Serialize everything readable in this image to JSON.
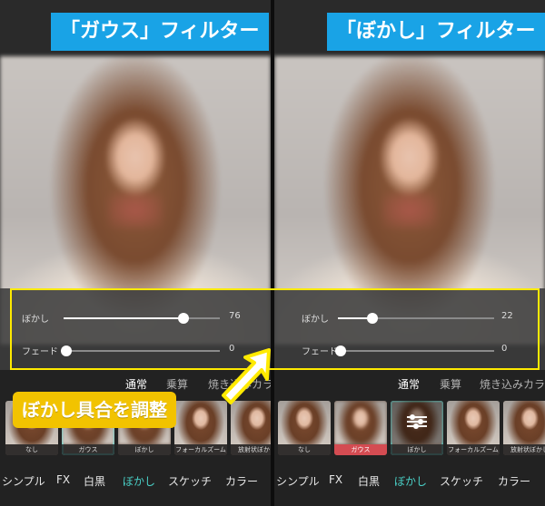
{
  "left": {
    "title": "「ガウス」フィルター",
    "sliders": [
      {
        "label": "ぼかし",
        "value": "76",
        "level": 76
      },
      {
        "label": "フェード",
        "value": "0",
        "level": 0
      }
    ],
    "modes": [
      {
        "label": "通常",
        "active": true
      },
      {
        "label": "乗算",
        "active": false
      },
      {
        "label": "焼き込みカラー",
        "active": false
      }
    ],
    "thumbs": [
      {
        "label": "なし"
      },
      {
        "label": "ガウス",
        "selected": true
      },
      {
        "label": "ぼかし"
      },
      {
        "label": "フォーカルズーム"
      },
      {
        "label": "放射状ぼかし"
      }
    ],
    "categories": [
      {
        "label": "シンプル",
        "active": false
      },
      {
        "label": "FX",
        "active": false
      },
      {
        "label": "白黒",
        "active": false
      },
      {
        "label": "ぼかし",
        "active": true
      },
      {
        "label": "スケッチ",
        "active": false
      },
      {
        "label": "カラー",
        "active": false
      }
    ]
  },
  "right": {
    "title": "「ぼかし」フィルター",
    "sliders": [
      {
        "label": "ぼかし",
        "value": "22",
        "level": 22
      },
      {
        "label": "フェード",
        "value": "0",
        "level": 0
      }
    ],
    "modes": [
      {
        "label": "通常",
        "active": true
      },
      {
        "label": "乗算",
        "active": false
      },
      {
        "label": "焼き込みカラー",
        "active": false
      }
    ],
    "thumbs": [
      {
        "label": "なし"
      },
      {
        "label": "ガウス"
      },
      {
        "label": "ぼかし",
        "selected": true
      },
      {
        "label": "フォーカルズーム"
      },
      {
        "label": "放射状ぼかし"
      }
    ],
    "categories": [
      {
        "label": "シンプル",
        "active": false
      },
      {
        "label": "FX",
        "active": false
      },
      {
        "label": "白黒",
        "active": false
      },
      {
        "label": "ぼかし",
        "active": true
      },
      {
        "label": "スケッチ",
        "active": false
      },
      {
        "label": "カラー",
        "active": false
      }
    ]
  },
  "annotation": {
    "callout": "ぼかし具合を調整"
  },
  "colors": {
    "title_bg": "#19a3e6",
    "highlight": "#ffea00",
    "callout_bg": "#f2c300",
    "accent": "#4ad1c8",
    "gauss_caption": "#d44c52"
  }
}
